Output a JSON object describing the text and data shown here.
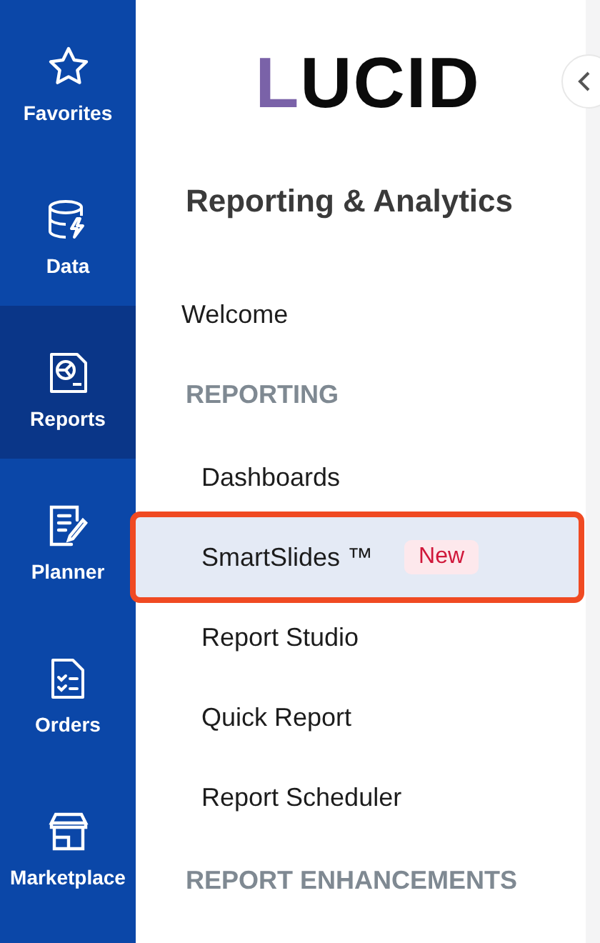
{
  "rail": [
    {
      "label": "Favorites",
      "selected": false
    },
    {
      "label": "Data",
      "selected": false
    },
    {
      "label": "Reports",
      "selected": true
    },
    {
      "label": "Planner",
      "selected": false
    },
    {
      "label": "Orders",
      "selected": false
    },
    {
      "label": "Marketplace",
      "selected": false
    }
  ],
  "logo": "LUCID",
  "title": "Reporting & Analytics",
  "menu": [
    {
      "kind": "top",
      "label": "Welcome",
      "selected": false
    },
    {
      "kind": "section",
      "label": "REPORTING"
    },
    {
      "kind": "item",
      "label": "Dashboards",
      "selected": false
    },
    {
      "kind": "item",
      "label": "SmartSlides ™",
      "badge": "New",
      "selected": true,
      "highlighted": true
    },
    {
      "kind": "item",
      "label": "Report Studio",
      "selected": false
    },
    {
      "kind": "item",
      "label": "Quick Report",
      "selected": false
    },
    {
      "kind": "item",
      "label": "Report Scheduler",
      "selected": false
    },
    {
      "kind": "section",
      "label": "REPORT ENHANCEMENTS"
    }
  ]
}
